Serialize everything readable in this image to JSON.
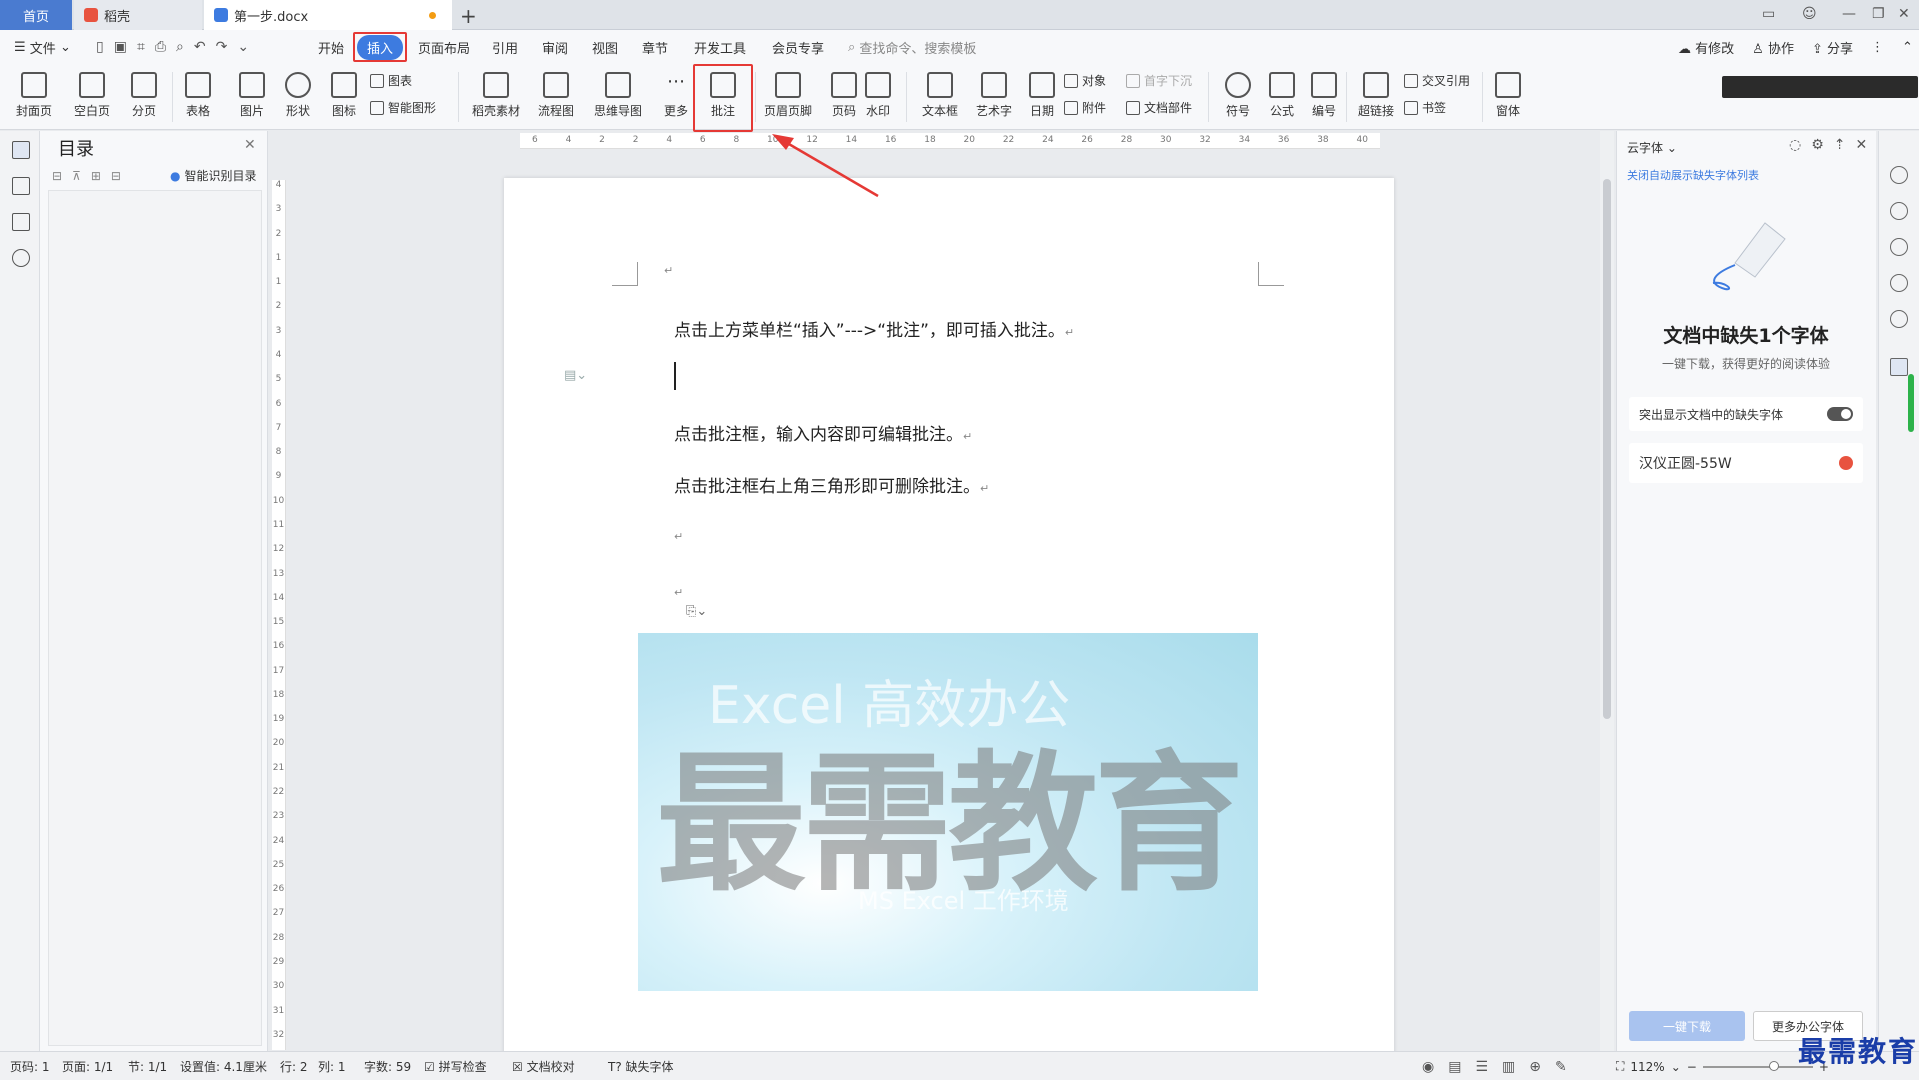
{
  "tabs": {
    "home": "首页",
    "daoke": "稻壳",
    "doc": "第一步.docx"
  },
  "menu": {
    "file": "文件",
    "items": [
      "开始",
      "插入",
      "页面布局",
      "引用",
      "审阅",
      "视图",
      "章节",
      "开发工具",
      "会员专享"
    ],
    "search": "查找命令、搜索模板",
    "right": [
      "有修改",
      "协作",
      "分享"
    ]
  },
  "ribbon": {
    "buttons": [
      "封面页",
      "空白页",
      "分页",
      "表格",
      "图片",
      "形状",
      "图标",
      "稻壳素材",
      "流程图",
      "思维导图",
      "更多",
      "批注",
      "页眉页脚",
      "页码",
      "水印",
      "文本框",
      "艺术字",
      "日期",
      "符号",
      "公式",
      "编号",
      "超链接",
      "窗体"
    ],
    "small": [
      "图表",
      "智能图形",
      "对象",
      "附件",
      "首字下沉",
      "文档部件",
      "交叉引用",
      "书签"
    ]
  },
  "toc": {
    "title": "目录",
    "smart": "智能识别目录"
  },
  "document": {
    "paragraphs": [
      "点击上方菜单栏“插入”--->“批注”，即可插入批注。",
      "点击批注框，输入内容即可编辑批注。",
      "点击批注框右上角三角形即可删除批注。"
    ],
    "picture": {
      "big": "最需教育",
      "top": "Excel 高效办公",
      "bottom": "MS Excel 工作环境"
    }
  },
  "ruler": {
    "h": [
      "6",
      "4",
      "2",
      "2",
      "4",
      "6",
      "8",
      "10",
      "12",
      "14",
      "16",
      "18",
      "20",
      "22",
      "24",
      "26",
      "28",
      "30",
      "32",
      "34",
      "36",
      "38",
      "40"
    ],
    "v": [
      "4",
      "3",
      "2",
      "1",
      "1",
      "2",
      "3",
      "4",
      "5",
      "6",
      "7",
      "8",
      "9",
      "10",
      "11",
      "12",
      "13",
      "14",
      "15",
      "16",
      "17",
      "18",
      "19",
      "20",
      "21",
      "22",
      "23",
      "24",
      "25",
      "26",
      "27",
      "28",
      "29",
      "30",
      "31",
      "32"
    ]
  },
  "cloudfont": {
    "header": "云字体",
    "close_auto": "关闭自动展示缺失字体列表",
    "title": "文档中缺失1个字体",
    "subtitle": "一键下载，获得更好的阅读体验",
    "toggle_label": "突出显示文档中的缺失字体",
    "font_name": "汉仪正圆-55W",
    "download_btn": "一键下载",
    "more_btn": "更多办公字体"
  },
  "status": {
    "items": [
      "页码: 1",
      "页面: 1/1",
      "节: 1/1",
      "设置值: 4.1厘米",
      "行: 2",
      "列: 1",
      "字数: 59",
      "拼写检查",
      "文档校对",
      "缺失字体"
    ],
    "zoom": "112%"
  },
  "brand": "最需教育",
  "colors": {
    "accent": "#3d7be0",
    "highlight": "#e53935"
  }
}
